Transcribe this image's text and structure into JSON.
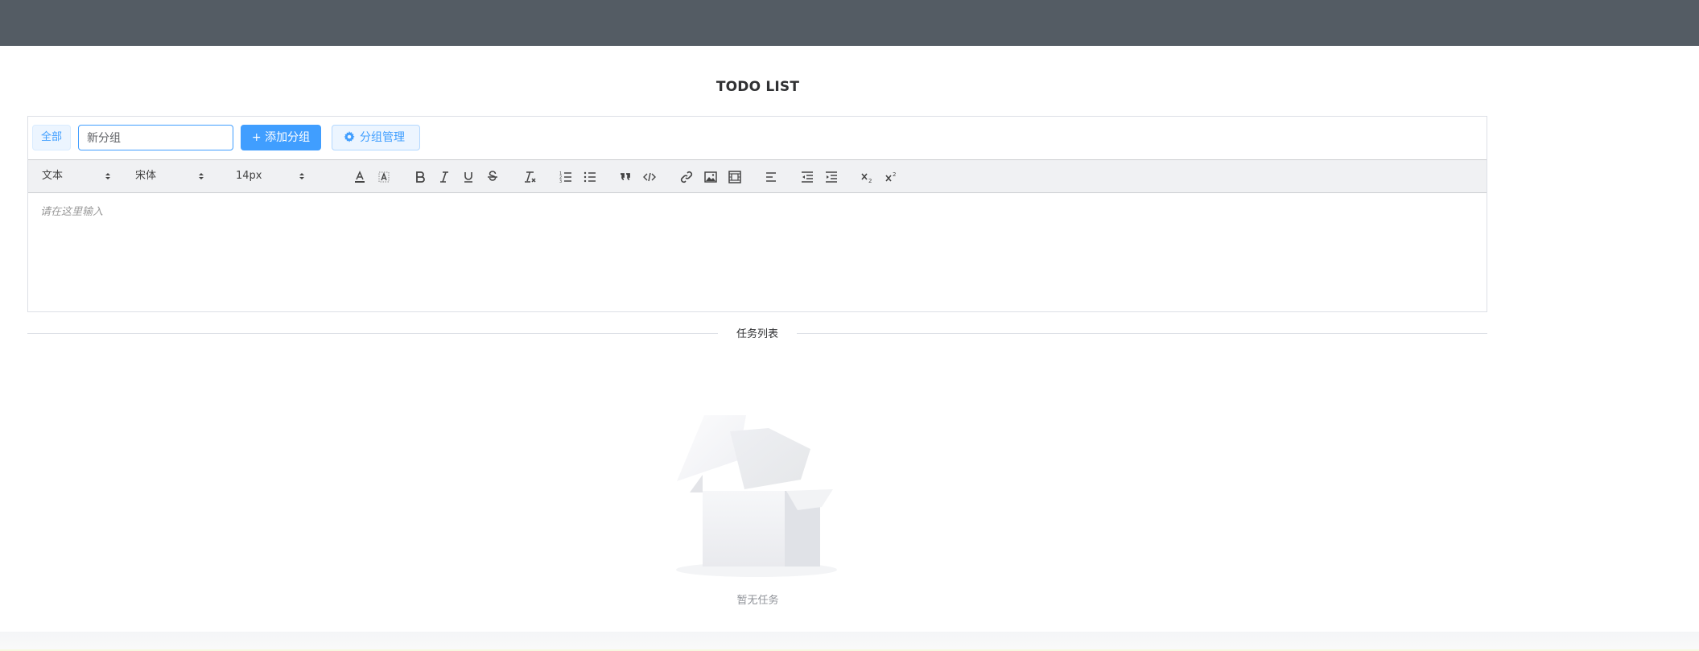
{
  "app": {
    "title": "TODO LIST"
  },
  "groups": {
    "all_tag": "全部",
    "input_value": "新分组",
    "add_button": "+ 添加分组",
    "manage_button": "分组管理"
  },
  "toolbar": {
    "header_picker": "文本",
    "font_picker": "宋体",
    "size_picker": "14px"
  },
  "editor": {
    "placeholder": "请在这里输入"
  },
  "task_list": {
    "divider_label": "任务列表",
    "empty_text": "暂无任务"
  },
  "colors": {
    "topbar": "#545c64",
    "primary": "#409eff",
    "toolbar_bg": "#f0f1f3",
    "border": "#dcdfe6"
  },
  "icons": [
    "gear-icon",
    "text-color-icon",
    "background-color-icon",
    "bold-icon",
    "italic-icon",
    "underline-icon",
    "strike-icon",
    "clear-format-icon",
    "ordered-list-icon",
    "bullet-list-icon",
    "blockquote-icon",
    "code-icon",
    "link-icon",
    "image-icon",
    "video-icon",
    "align-left-icon",
    "outdent-icon",
    "indent-icon",
    "subscript-icon",
    "superscript-icon",
    "empty-box-icon"
  ]
}
